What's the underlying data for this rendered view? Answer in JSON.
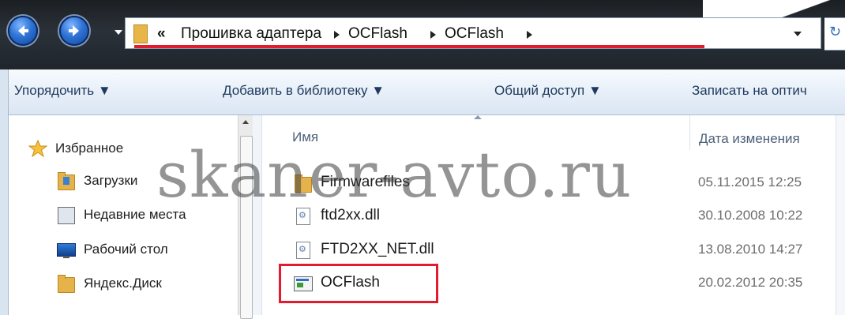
{
  "address_bar": {
    "overflow_chevron": "«",
    "crumbs": [
      "Прошивка адаптера",
      "OCFlash",
      "OCFlash"
    ]
  },
  "toolbar": {
    "items": [
      "Упорядочить ▼",
      "Добавить в библиотеку ▼",
      "Общий доступ ▼",
      "Записать на оптич"
    ]
  },
  "nav_pane": {
    "items": [
      {
        "label": "Избранное",
        "icon": "star-icon"
      },
      {
        "label": "Загрузки",
        "icon": "downloads-folder-icon"
      },
      {
        "label": "Недавние места",
        "icon": "recent-places-icon"
      },
      {
        "label": "Рабочий стол",
        "icon": "desktop-icon"
      },
      {
        "label": "Яндекс.Диск",
        "icon": "folder-icon"
      }
    ]
  },
  "file_list": {
    "headers": {
      "name": "Имя",
      "date": "Дата изменения"
    },
    "rows": [
      {
        "name": "Firmwarefiles",
        "date": "05.11.2015 12:25",
        "icon": "folder-icon"
      },
      {
        "name": "ftd2xx.dll",
        "date": "30.10.2008 10:22",
        "icon": "dll-file-icon"
      },
      {
        "name": "FTD2XX_NET.dll",
        "date": "13.08.2010 14:27",
        "icon": "dll-file-icon"
      },
      {
        "name": "OCFlash",
        "date": "20.02.2012 20:35",
        "icon": "application-icon"
      }
    ]
  },
  "watermark": "skaner-avto.ru",
  "colors": {
    "highlight_red": "#e21b2d",
    "toolbar_text": "#1e395b"
  }
}
